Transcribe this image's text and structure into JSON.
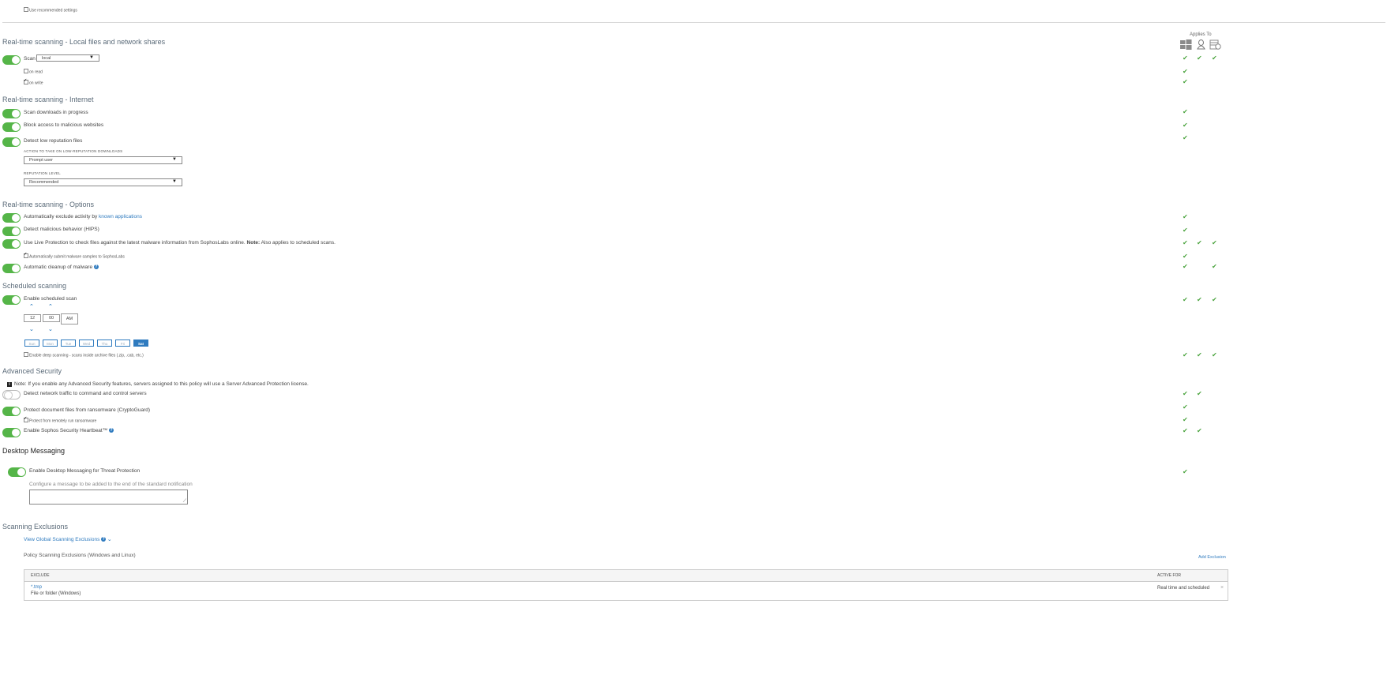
{
  "top": {
    "recommended_label": "Use recommended settings"
  },
  "applies_to": {
    "label": "Applies To",
    "icons": [
      "windows-icon",
      "linux-icon",
      "server-icon"
    ]
  },
  "local": {
    "title": "Real-time scanning - Local files and network shares",
    "scan_label": "Scan",
    "scan_value": "local",
    "on_read": "on read",
    "on_write": "on write"
  },
  "internet": {
    "title": "Real-time scanning - Internet",
    "scan_downloads": "Scan downloads in progress",
    "block_access": "Block access to malicious websites",
    "detect_low_rep": "Detect low reputation files",
    "action_label": "ACTION TO TAKE ON LOW-REPUTATION DOWNLOADS",
    "action_value": "Prompt user",
    "rep_level_label": "REPUTATION LEVEL",
    "rep_level_value": "Recommended"
  },
  "options": {
    "title": "Real-time scanning - Options",
    "auto_exclude_prefix": "Automatically exclude activity by",
    "auto_exclude_link": "known applications",
    "hips": "Detect malicious behavior (HIPS)",
    "live_protection": "Use Live Protection to check files against the latest malware information from SophosLabs online.",
    "live_note_bold": "Note:",
    "live_note": "Also applies to scheduled scans.",
    "submit_samples": "Automatically submit malware samples to SophosLabs",
    "auto_cleanup": "Automatic cleanup of malware"
  },
  "scheduled": {
    "title": "Scheduled scanning",
    "enable": "Enable scheduled scan",
    "hour": "12",
    "minute": "00",
    "ampm": "AM",
    "days": [
      "Sun",
      "Mon",
      "Tue",
      "Wed",
      "Thu",
      "Fri",
      "Sat"
    ],
    "selected_day": "Sat",
    "deep_scan": "Enable deep scanning - scans inside archive files (.zip, .cab, etc.)"
  },
  "advanced": {
    "title": "Advanced Security",
    "note": "Note: If you enable any Advanced Security features, servers assigned to this policy will use a Server Advanced Protection license.",
    "network_traffic": "Detect network traffic to command and control servers",
    "cryptoguard": "Protect document files from ransomware (CryptoGuard)",
    "remote_ransomware": "Protect from remotely run ransomware",
    "heartbeat": "Enable Sophos Security Heartbeat™"
  },
  "messaging": {
    "title": "Desktop Messaging",
    "enable": "Enable Desktop Messaging for Threat Protection",
    "configure": "Configure a message to be added to the end of the standard notification"
  },
  "exclusions": {
    "title": "Scanning Exclusions",
    "view_global": "View Global Scanning Exclusions",
    "policy_title": "Policy Scanning Exclusions (Windows and Linux)",
    "add_exclusion": "Add Exclusion",
    "col_exclude": "EXCLUDE",
    "col_active": "ACTIVE FOR",
    "rows": [
      {
        "pattern": "*.tmp",
        "type": "File or folder (Windows)",
        "active_for": "Real time and scheduled"
      }
    ]
  },
  "colors": {
    "toggle_on": "#55b548",
    "check": "#4aa33d",
    "link": "#2f7bbf"
  }
}
